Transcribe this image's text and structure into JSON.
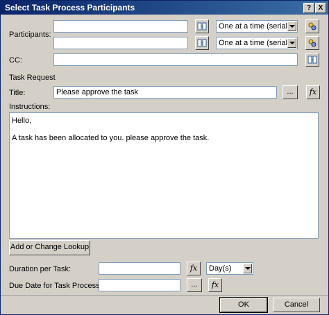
{
  "dialog": {
    "title": "Select Task Process Participants",
    "help_label": "?",
    "close_label": "X"
  },
  "participants": {
    "label": "Participants:",
    "rows": [
      {
        "value": "",
        "order": "One at a time (serial)"
      },
      {
        "value": "",
        "order": "One at a time (serial)"
      }
    ]
  },
  "cc": {
    "label": "CC:",
    "value": ""
  },
  "task_request": {
    "heading": "Task Request",
    "title_label": "Title:",
    "title_value": "Please approve the task",
    "browse_label": "...",
    "fx_label": "fx",
    "instructions_label": "Instructions:",
    "instructions_lines": [
      "Hello,",
      "",
      "A task has been allocated to you. please approve the task."
    ]
  },
  "lookup_button": "Add or Change Lookup",
  "duration": {
    "label": "Duration per Task:",
    "value": "",
    "unit": "Day(s)"
  },
  "due_date": {
    "label": "Due Date for Task Process:",
    "value": ""
  },
  "footer": {
    "ok": "OK",
    "cancel": "Cancel"
  },
  "icons": {
    "address_book": "address-book-icon",
    "role_picker": "workflow-role-icon",
    "function": "function-icon"
  }
}
